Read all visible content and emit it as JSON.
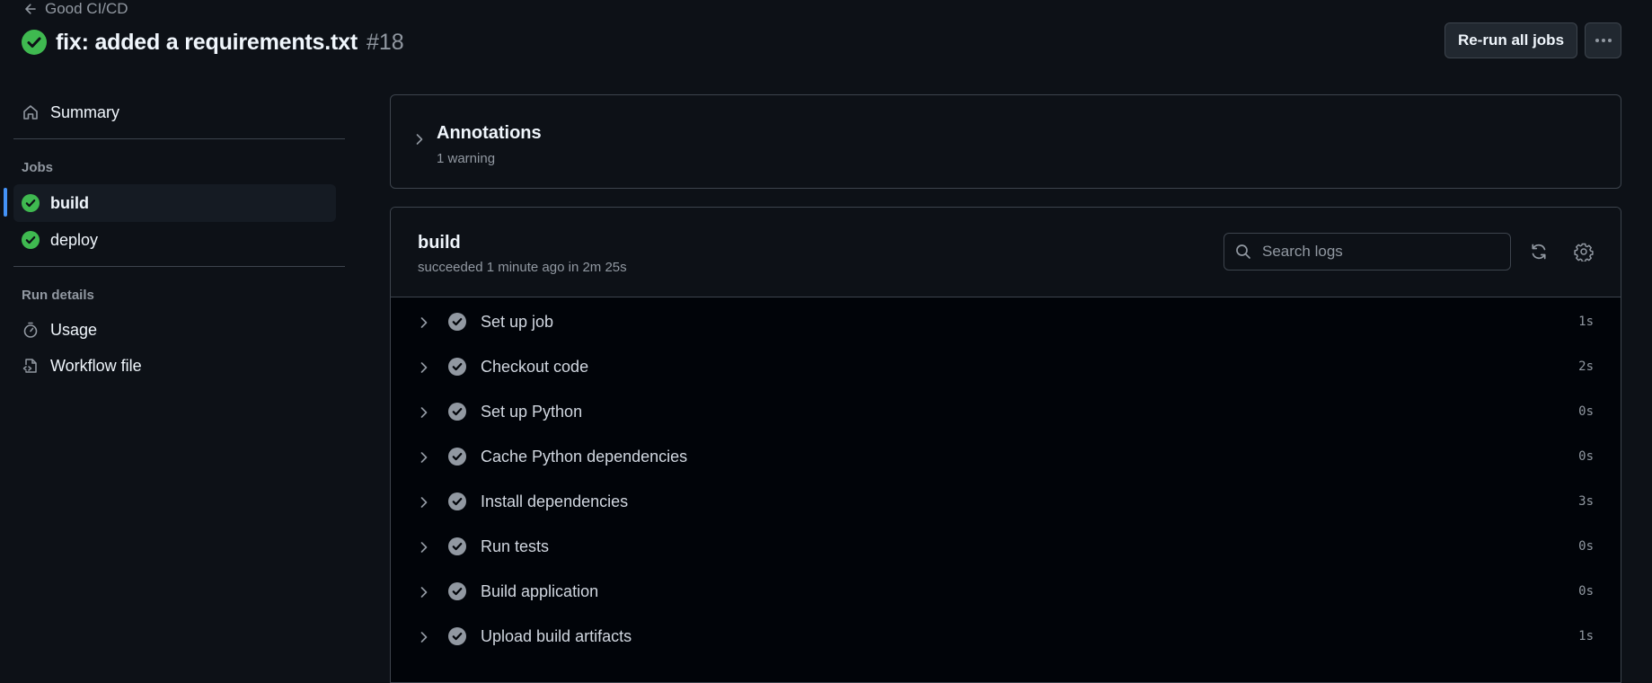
{
  "header": {
    "back_label": "Good CI/CD",
    "title": "fix: added a requirements.txt",
    "run_number": "#18",
    "rerun_label": "Re-run all jobs"
  },
  "sidebar": {
    "summary_label": "Summary",
    "jobs_heading": "Jobs",
    "jobs": [
      {
        "label": "build",
        "status": "success",
        "active": true
      },
      {
        "label": "deploy",
        "status": "success",
        "active": false
      }
    ],
    "run_details_heading": "Run details",
    "usage_label": "Usage",
    "workflow_file_label": "Workflow file"
  },
  "annotations": {
    "title": "Annotations",
    "subtitle": "1 warning"
  },
  "job": {
    "name": "build",
    "status_text": "succeeded 1 minute ago in 2m 25s",
    "search_placeholder": "Search logs",
    "steps": [
      {
        "name": "Set up job",
        "duration": "1s"
      },
      {
        "name": "Checkout code",
        "duration": "2s"
      },
      {
        "name": "Set up Python",
        "duration": "0s"
      },
      {
        "name": "Cache Python dependencies",
        "duration": "0s"
      },
      {
        "name": "Install dependencies",
        "duration": "3s"
      },
      {
        "name": "Run tests",
        "duration": "0s"
      },
      {
        "name": "Build application",
        "duration": "0s"
      },
      {
        "name": "Upload build artifacts",
        "duration": "1s"
      }
    ]
  },
  "colors": {
    "background": "#0d1117",
    "success_green": "#3fb950",
    "active_accent": "#4493f8",
    "muted_text": "#9198a1",
    "border": "#3d444d"
  },
  "icons": {
    "back": "arrow-left-icon",
    "status": "check-circle-fill-icon",
    "more": "kebab-horizontal-icon",
    "summary": "home-icon",
    "usage": "stopwatch-icon",
    "workflow_file": "file-code-icon",
    "search": "search-icon",
    "refresh": "sync-icon",
    "settings": "gear-icon",
    "expand": "chevron-right-icon"
  }
}
